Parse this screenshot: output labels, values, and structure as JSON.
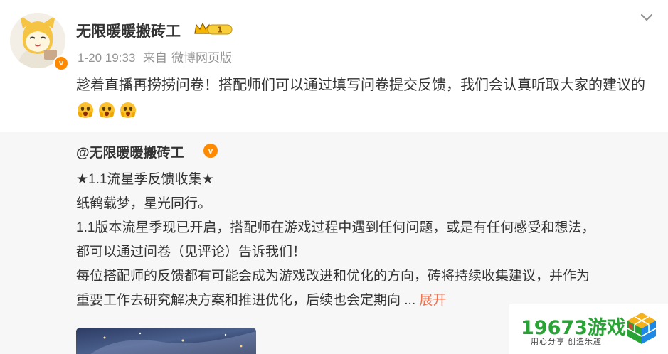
{
  "post": {
    "username": "无限暖暖搬砖工",
    "vip_level": "1",
    "timestamp": "1-20 19:33",
    "source_prefix": "来自",
    "source": "微博网页版",
    "text": "趁着直播再捞捞问卷！搭配师们可以通过填写问卷提交反馈，我们会认真听取大家的建议的"
  },
  "repost": {
    "author": "@无限暖暖搬砖工",
    "lines": [
      "★1.1流星季反馈收集★",
      "纸鹤载梦，星光同行。",
      "1.1版本流星季现已开启，搭配师在游戏过程中遇到任何问题，或是有任何感受和想法，",
      "都可以通过问卷（见评论）告诉我们！",
      "每位搭配师的反馈都有可能会成为游戏改进和优化的方向，砖将持续收集建议，并作为",
      "重要工作去研究解决方案和推进优化，后续也会定期向 ..."
    ],
    "expand_label": "展开"
  },
  "watermark": {
    "brand": "19673游戏",
    "slogan": "用心分享 创造乐趣!"
  },
  "colors": {
    "accent": "#eb7350",
    "meta": "#939393",
    "verified": "#ff8a00",
    "repost_bg": "#f7f7f7"
  }
}
